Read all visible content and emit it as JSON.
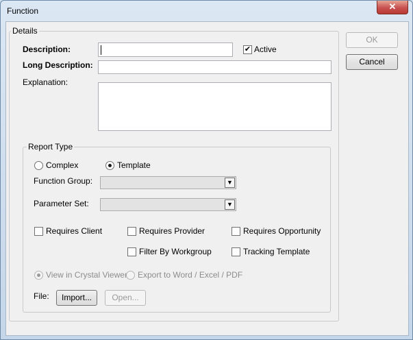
{
  "window": {
    "title": "Function",
    "close_glyph": "✕"
  },
  "buttons": {
    "ok": "OK",
    "cancel": "Cancel"
  },
  "details": {
    "group_label": "Details",
    "description_label": "Description:",
    "description_value": "",
    "active_label": "Active",
    "active_checked": true,
    "long_description_label": "Long Description:",
    "long_description_value": "",
    "explanation_label": "Explanation:",
    "explanation_value": ""
  },
  "report_type": {
    "group_label": "Report Type",
    "complex_label": "Complex",
    "complex_selected": false,
    "template_label": "Template",
    "template_selected": true,
    "function_group_label": "Function Group:",
    "function_group_value": "",
    "parameter_set_label": "Parameter Set:",
    "parameter_set_value": "",
    "requires_client_label": "Requires Client",
    "requires_provider_label": "Requires Provider",
    "requires_opportunity_label": "Requires Opportunity",
    "filter_by_workgroup_label": "Filter By Workgroup",
    "tracking_template_label": "Tracking Template",
    "view_in_crystal_label": "View in Crystal Viewer",
    "export_label": "Export to Word / Excel / PDF",
    "file_label": "File:",
    "import_button": "Import...",
    "open_button": "Open..."
  },
  "icons": {
    "check": "✔",
    "dropdown_arrow": "▼"
  }
}
